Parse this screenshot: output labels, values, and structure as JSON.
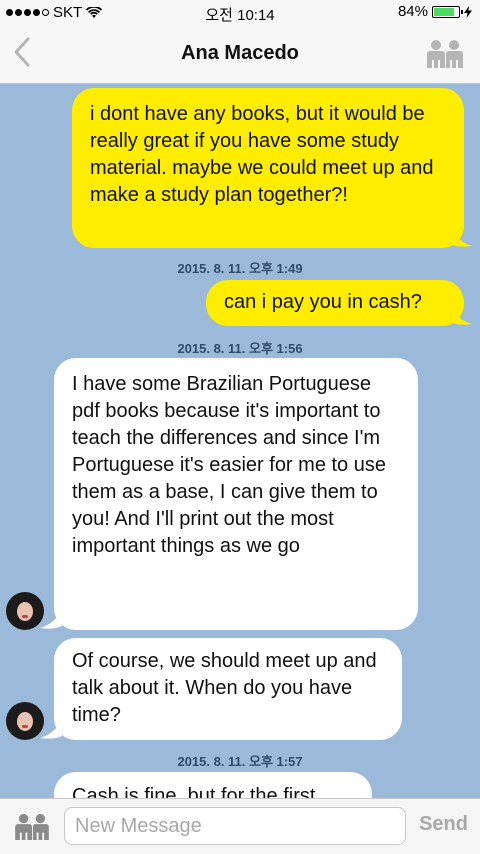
{
  "status_bar": {
    "carrier": "SKT",
    "time": "오전 10:14",
    "battery_percent": "84%",
    "battery_level": 0.84,
    "signal_bars_filled": 4,
    "signal_bars_total": 5
  },
  "header": {
    "title": "Ana Macedo",
    "back_icon": "chevron-left-icon",
    "menu_icon": "people-icon"
  },
  "messages": [
    {
      "sender": "me",
      "text": "i dont have any books, but it would be really great if you have some study material. maybe we could meet up and make a study plan together?!"
    },
    {
      "type": "timestamp",
      "text": "2015. 8. 11. 오후 1:49"
    },
    {
      "sender": "me",
      "text": "can i pay you in cash?"
    },
    {
      "type": "timestamp",
      "text": "2015. 8. 11. 오후 1:56"
    },
    {
      "sender": "other",
      "text": "I have some Brazilian Portuguese pdf books because it's important to teach the differences and since I'm Portuguese it's easier for me to use them as a base, I can give them to you! And I'll print out the most important things as we go"
    },
    {
      "sender": "other",
      "text": "Of course, we should meet up and talk about it. When do you have time?"
    },
    {
      "type": "timestamp",
      "text": "2015. 8. 11. 오후 1:57"
    },
    {
      "sender": "other",
      "text": "Cash is fine, but for the first"
    }
  ],
  "input": {
    "placeholder": "New Message",
    "send_label": "Send"
  },
  "colors": {
    "background": "#9bbad9",
    "my_bubble": "#ffed00",
    "other_bubble": "#ffffff",
    "timestamp_text": "#2f4b6b"
  }
}
